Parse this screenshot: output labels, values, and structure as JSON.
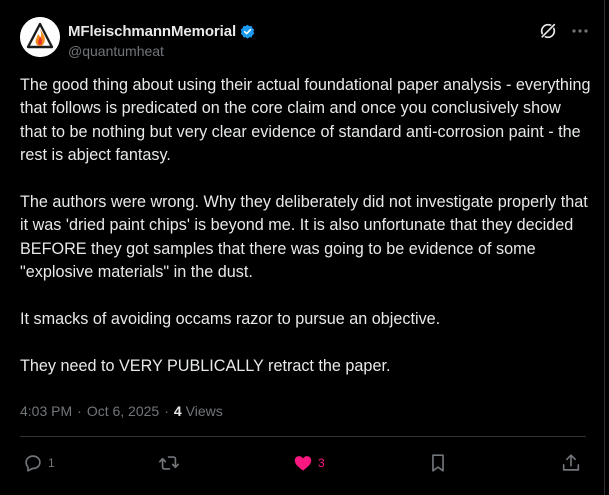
{
  "author": {
    "display_name": "MFleischmannMemorial",
    "handle": "@quantumheat",
    "verified": true,
    "avatar_icon": "flame-logo-icon"
  },
  "header_actions": {
    "grok_icon": "grok-icon",
    "more_icon": "more-horizontal-icon"
  },
  "post": {
    "paragraphs": [
      "The good thing about using their actual foundational paper analysis - everything that follows is predicated on the core claim and once you conclusively show that to be nothing but very clear evidence of standard anti-corrosion paint - the rest is abject fantasy.",
      "The authors were wrong. Why they deliberately did not investigate properly that it was 'dried paint chips' is beyond me. It is also unfortunate that they decided BEFORE they got samples that there was going to be evidence of some \"explosive materials\" in the dust.",
      "It smacks of avoiding occams razor to pursue an objective.",
      "They need to VERY PUBLICALLY retract the paper."
    ],
    "time": "4:03 PM",
    "separator": "·",
    "date": "Oct 6, 2025",
    "views_count": "4",
    "views_label": "Views"
  },
  "actions": {
    "reply_count": "1",
    "repost_count": "",
    "like_count": "3",
    "liked": true
  },
  "colors": {
    "background": "#000000",
    "text": "#e7e9ea",
    "muted": "#71767b",
    "verified_blue": "#1d9bf0",
    "like_pink": "#f91880",
    "divider": "#2f3336"
  }
}
